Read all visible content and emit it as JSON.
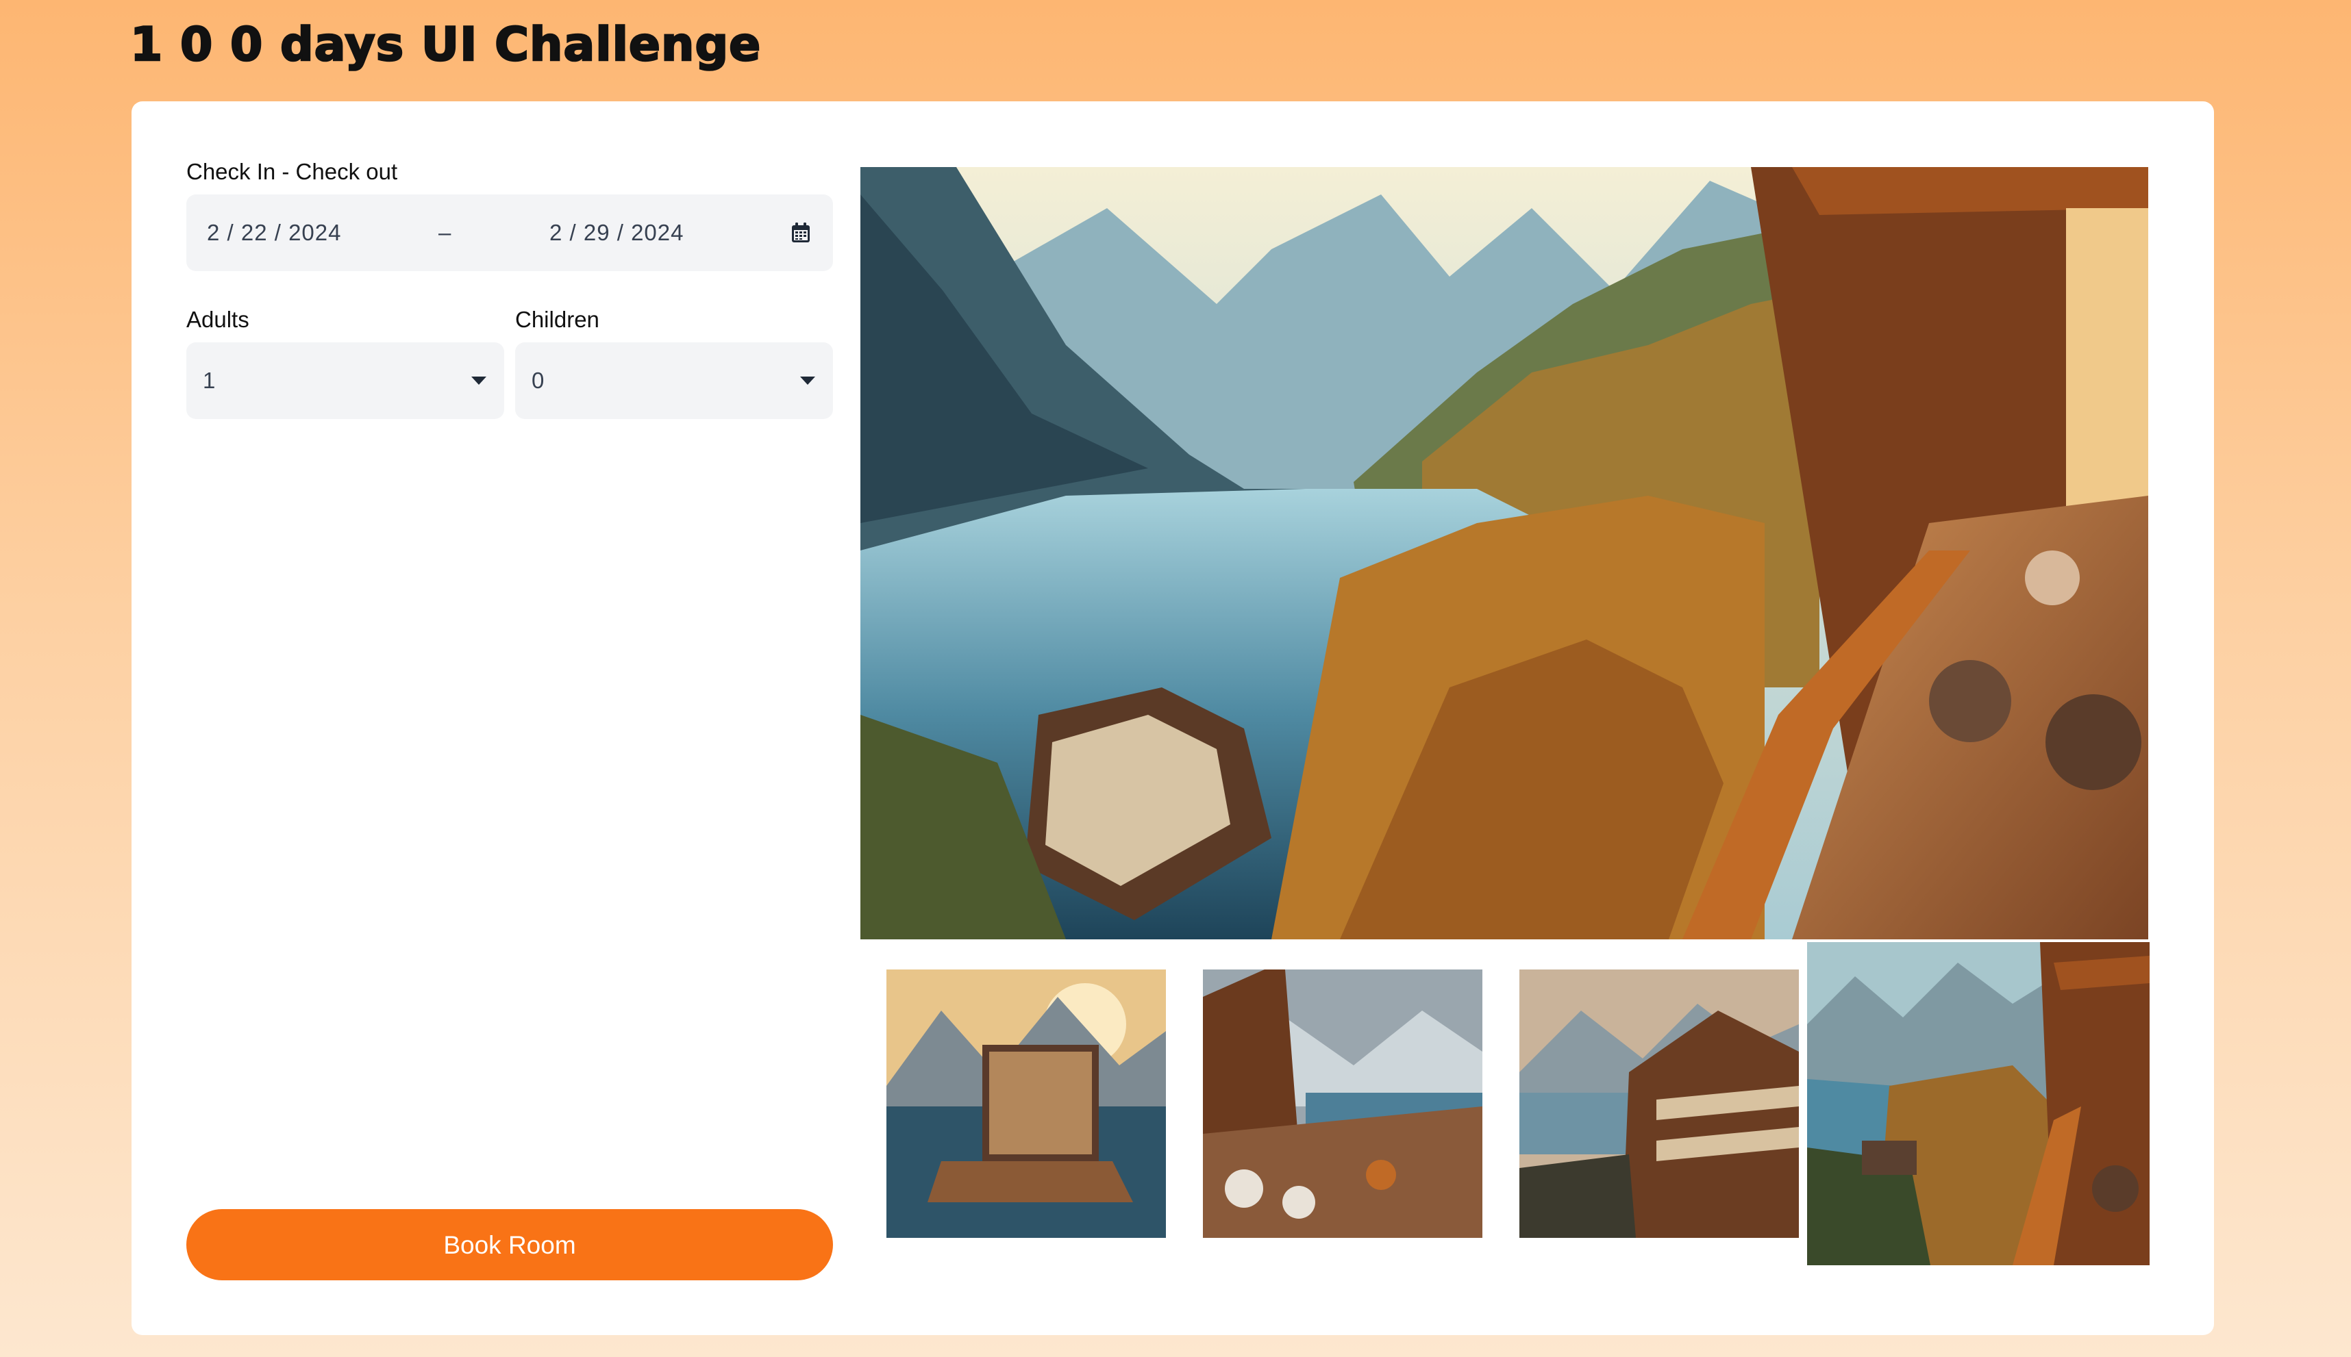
{
  "page": {
    "title": "1 0 0 days UI Challenge"
  },
  "booking": {
    "dates_label": "Check In - Check out",
    "check_in": "2 / 22 / 2024",
    "separator": "–",
    "check_out": "2 / 29 / 2024",
    "adults_label": "Adults",
    "adults_value": "1",
    "children_label": "Children",
    "children_value": "0",
    "book_label": "Book Room"
  },
  "gallery": {
    "main_image": "mountain-lake-hotel-balcony-photo",
    "thumbnails": [
      "lakeside-hotel-sunset-photo",
      "hotel-terrace-lake-view-photo",
      "hotel-balconies-lake-photo",
      "mountain-lake-hotel-balcony-photo"
    ],
    "selected_index": 3
  },
  "colors": {
    "accent": "#f97316",
    "background_top": "#fdb672",
    "background_bottom": "#fde7cf",
    "field_bg": "#f3f4f6"
  }
}
